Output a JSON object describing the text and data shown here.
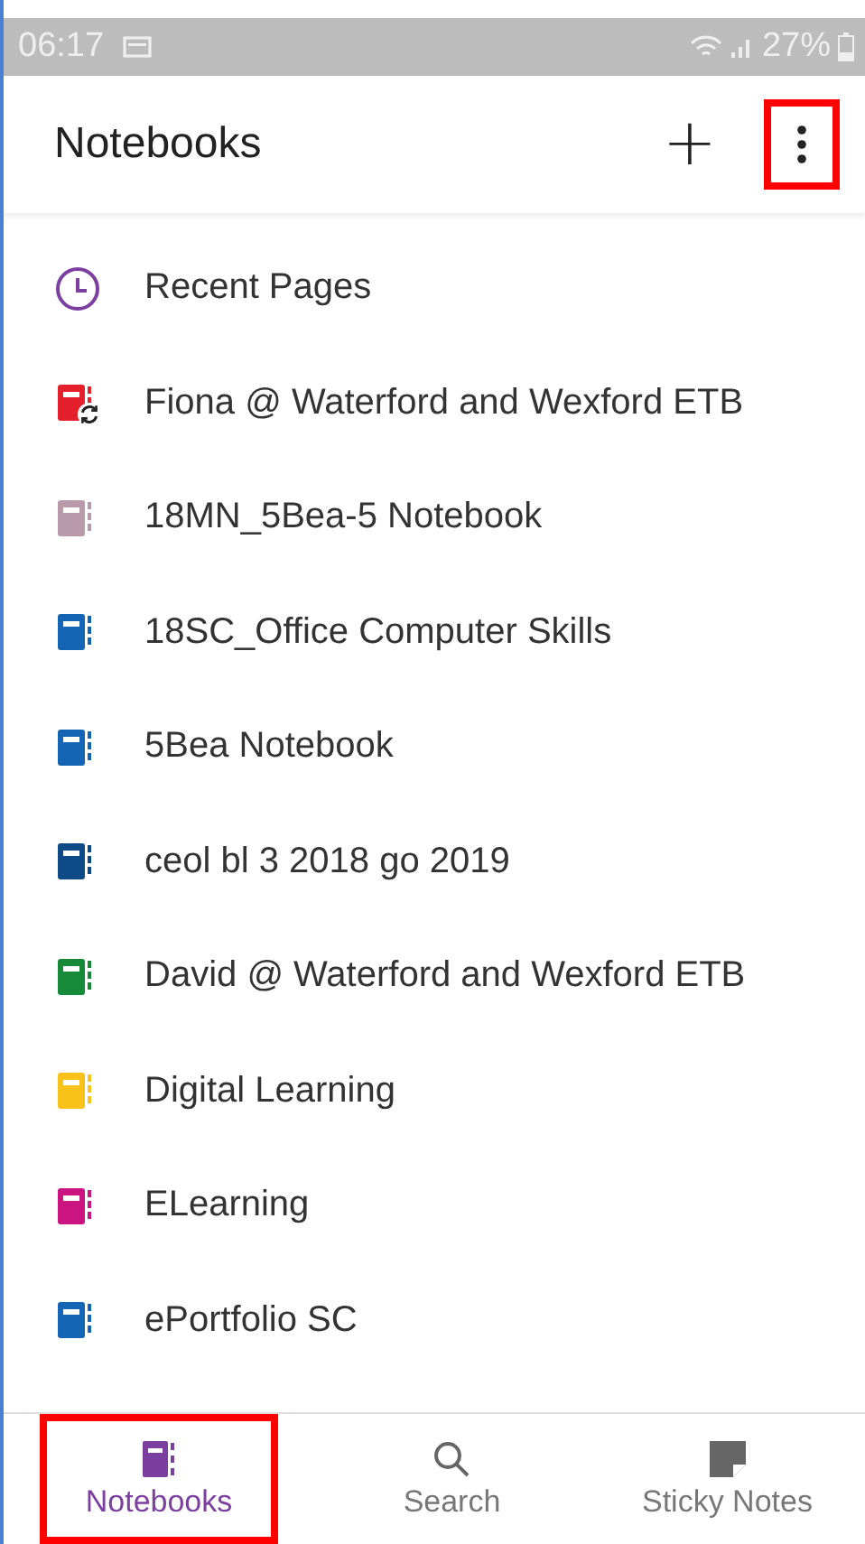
{
  "status_bar": {
    "time": "06:17",
    "battery": "27%"
  },
  "header": {
    "title": "Notebooks",
    "add_icon": "+",
    "more_highlighted": true
  },
  "items": [
    {
      "kind": "recent",
      "label": "Recent Pages",
      "color": "#7b3fa0",
      "syncing": false
    },
    {
      "kind": "notebook",
      "label": "Fiona @ Waterford and Wexford ETB",
      "color": "#e3202b",
      "syncing": true
    },
    {
      "kind": "notebook",
      "label": "18MN_5Bea-5 Notebook",
      "color": "#b89aaa",
      "syncing": false
    },
    {
      "kind": "notebook",
      "label": "18SC_Office Computer Skills",
      "color": "#1565b5",
      "syncing": false
    },
    {
      "kind": "notebook",
      "label": "5Bea Notebook",
      "color": "#1565b5",
      "syncing": false
    },
    {
      "kind": "notebook",
      "label": "ceol bl 3 2018 go 2019",
      "color": "#0e4a88",
      "syncing": false
    },
    {
      "kind": "notebook",
      "label": "David @ Waterford and Wexford ETB",
      "color": "#178a3a",
      "syncing": false
    },
    {
      "kind": "notebook",
      "label": "Digital Learning",
      "color": "#f9c21b",
      "syncing": false
    },
    {
      "kind": "notebook",
      "label": "ELearning",
      "color": "#cc1480",
      "syncing": false
    },
    {
      "kind": "notebook",
      "label": "ePortfolio SC",
      "color": "#1565b5",
      "syncing": false
    }
  ],
  "bottom_nav": [
    {
      "kind": "notebooks",
      "label": "Notebooks",
      "selected": true,
      "highlighted": true
    },
    {
      "kind": "search",
      "label": "Search",
      "selected": false,
      "highlighted": false
    },
    {
      "kind": "sticky",
      "label": "Sticky Notes",
      "selected": false,
      "highlighted": false
    }
  ]
}
